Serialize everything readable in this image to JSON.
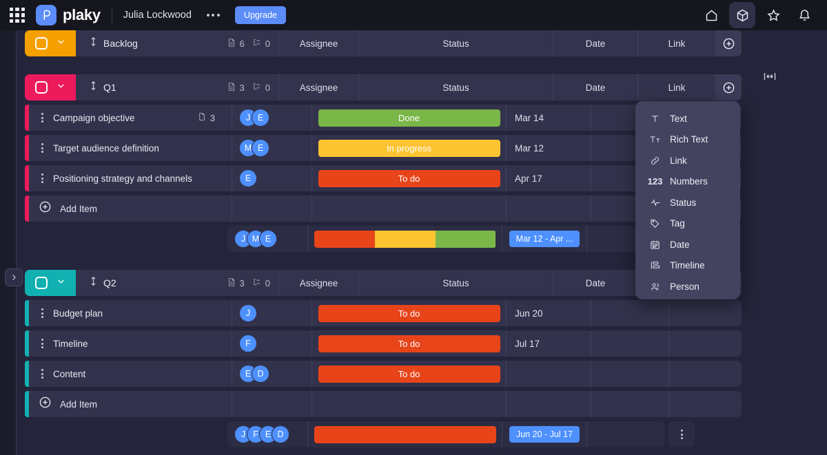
{
  "topbar": {
    "apps_icon": "grid-apps-icon",
    "brand": "plaky",
    "username": "Julia Lockwood",
    "more_icon": "ellipsis-horizontal-icon",
    "upgrade_label": "Upgrade",
    "right_icons": [
      {
        "name": "home-icon",
        "active": false
      },
      {
        "name": "cube-icon",
        "active": true
      },
      {
        "name": "star-icon",
        "active": false
      },
      {
        "name": "bell-icon",
        "active": false
      }
    ]
  },
  "board": {
    "collapse_icon": "chevron-right-icon",
    "resize_icon": "horizontal-resize-icon",
    "columns": [
      "Assignee",
      "Status",
      "Date",
      "Link"
    ],
    "add_column_icon": "plus-circle-icon",
    "add_item_label": "Add Item",
    "doc_icon": "document-icon",
    "subitem_icon": "subitem-icon",
    "drag_icon": "drag-vertical-icon",
    "row_menu_icon": "dots-vertical-icon",
    "groups": [
      {
        "name": "Backlog",
        "color": "#f5a001",
        "doc_count": "6",
        "subitem_count": "0",
        "collapsed": true,
        "tasks": [],
        "summary": null
      },
      {
        "name": "Q1",
        "color": "#ed1b5c",
        "doc_count": "3",
        "subitem_count": "0",
        "collapsed": false,
        "tasks": [
          {
            "title": "Campaign objective",
            "doc_count": "3",
            "assignees": [
              "J",
              "E"
            ],
            "status": {
              "label": "Done",
              "color": "#7ab648"
            },
            "date": "Mar 14",
            "link": ""
          },
          {
            "title": "Target audience definition",
            "doc_count": "",
            "assignees": [
              "M",
              "E"
            ],
            "status": {
              "label": "In progress",
              "color": "#fcc431"
            },
            "date": "Mar 12",
            "link": ""
          },
          {
            "title": "Positioning strategy and channels",
            "doc_count": "",
            "assignees": [
              "E"
            ],
            "status": {
              "label": "To do",
              "color": "#e8441a"
            },
            "date": "Apr 17",
            "link": ""
          }
        ],
        "summary": {
          "assignees": [
            "J",
            "M",
            "E"
          ],
          "segments": [
            {
              "color": "#e8441a",
              "pct": 33.4
            },
            {
              "color": "#fcc431",
              "pct": 33.3
            },
            {
              "color": "#7ab648",
              "pct": 33.3
            }
          ],
          "date_range": "Mar 12 - Apr ...",
          "menu": false
        }
      },
      {
        "name": "Q2",
        "color": "#12b1b1",
        "doc_count": "3",
        "subitem_count": "0",
        "collapsed": false,
        "tasks": [
          {
            "title": "Budget plan",
            "doc_count": "",
            "assignees": [
              "J"
            ],
            "status": {
              "label": "To do",
              "color": "#e8441a"
            },
            "date": "Jun 20",
            "link": ""
          },
          {
            "title": "Timeline",
            "doc_count": "",
            "assignees": [
              "F"
            ],
            "status": {
              "label": "To do",
              "color": "#e8441a"
            },
            "date": "Jul 17",
            "link": ""
          },
          {
            "title": "Content",
            "doc_count": "",
            "assignees": [
              "E",
              "D"
            ],
            "status": {
              "label": "To do",
              "color": "#e8441a"
            },
            "date": "",
            "link": ""
          }
        ],
        "summary": {
          "assignees": [
            "J",
            "F",
            "E",
            "D"
          ],
          "segments": [
            {
              "color": "#e8441a",
              "pct": 100
            }
          ],
          "date_range": "Jun 20 - Jul 17",
          "menu": true
        }
      }
    ]
  },
  "dropdown": {
    "items": [
      {
        "label": "Text",
        "icon": "text-icon"
      },
      {
        "label": "Rich Text",
        "icon": "rich-text-icon"
      },
      {
        "label": "Link",
        "icon": "link-icon"
      },
      {
        "label": "Numbers",
        "icon": "numbers-icon"
      },
      {
        "label": "Status",
        "icon": "status-pulse-icon"
      },
      {
        "label": "Tag",
        "icon": "tag-icon"
      },
      {
        "label": "Date",
        "icon": "calendar-icon"
      },
      {
        "label": "Timeline",
        "icon": "timeline-icon"
      },
      {
        "label": "Person",
        "icon": "person-icon"
      }
    ]
  }
}
